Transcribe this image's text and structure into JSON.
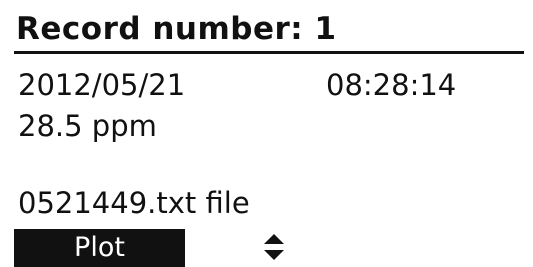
{
  "record": {
    "title": "Record number: 1",
    "date": "2012/05/21",
    "time": "08:28:14",
    "reading": "28.5 ppm",
    "file": "0521449.txt file"
  },
  "softkeys": {
    "left_label": "Plot",
    "scroll_icon": "up-down-arrows-icon"
  }
}
